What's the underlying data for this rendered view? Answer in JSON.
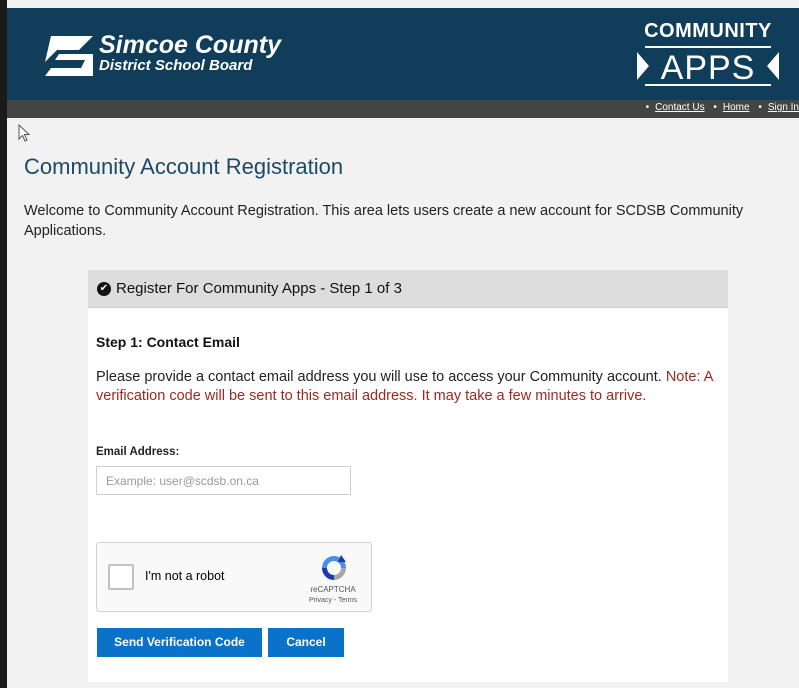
{
  "header": {
    "org_name_line1": "Simcoe County",
    "org_name_line2": "District School Board",
    "apps_badge_top": "COMMUNITY",
    "apps_badge_bottom": "APPS",
    "brand_colors": {
      "header_bg": "#0f3d5a",
      "nav_bg": "#444444"
    }
  },
  "nav": {
    "links": [
      "Contact Us",
      "Home",
      "Sign In"
    ]
  },
  "page": {
    "title": "Community Account Registration",
    "intro": "Welcome to Community Account Registration. This area lets users create a new account for SCDSB Community Applications."
  },
  "card": {
    "title": "Register For Community Apps - Step 1 of 3",
    "step_heading": "Step 1: Contact Email",
    "description": "Please provide a contact email address you will use to access your Community account.",
    "note": "Note: A verification code will be sent to this email address. It may take a few minutes to arrive.",
    "email_label": "Email Address:",
    "email_value": "",
    "email_placeholder": "Example: user@scdsb.on.ca",
    "captcha": {
      "label": "I'm not a robot",
      "brand": "reCAPTCHA",
      "links": "Privacy - Terms",
      "checked": false
    },
    "buttons": {
      "send": "Send Verification Code",
      "cancel": "Cancel"
    },
    "colors": {
      "button": "#0b72c9",
      "note": "#9a2a22",
      "title": "#1c4a66"
    }
  }
}
